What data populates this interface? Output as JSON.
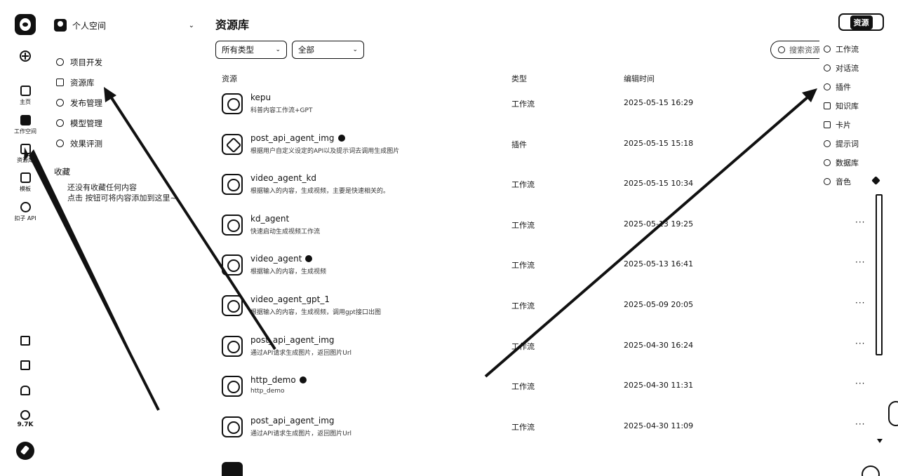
{
  "rail": {
    "items": [
      {
        "label": "主页",
        "icon": "home-icon"
      },
      {
        "label": "工作空间",
        "icon": "workspace-icon"
      },
      {
        "label": "资源库",
        "icon": "library-icon"
      },
      {
        "label": "模板",
        "icon": "template-icon"
      },
      {
        "label": "扣子 API",
        "icon": "api-icon"
      }
    ],
    "bottom": {
      "star_count": "9.7K"
    }
  },
  "sidebar": {
    "workspace": "个人空间",
    "menu": [
      {
        "label": "项目开发",
        "icon": "project-icon"
      },
      {
        "label": "资源库",
        "icon": "library-icon"
      },
      {
        "label": "发布管理",
        "icon": "rocket-icon"
      },
      {
        "label": "模型管理",
        "icon": "model-icon"
      },
      {
        "label": "效果评测",
        "icon": "evaluate-icon"
      }
    ],
    "favorites": {
      "title": "收藏",
      "empty_line1": "还没有收藏任何内容",
      "empty_line2": "点击 按钮可将内容添加到这里~"
    }
  },
  "main": {
    "title": "资源库",
    "type_filter": "所有类型",
    "scope_filter": "全部",
    "search_placeholder": "搜索资源",
    "resource_button": "资源",
    "columns": {
      "resource": "资源",
      "type": "类型",
      "edited": "编辑时间"
    },
    "rows": [
      {
        "name": "kepu",
        "desc": "科普内容工作流+GPT",
        "type": "工作流",
        "time": "2025-05-15 16:29",
        "badge": false,
        "icon": "workflow-icon"
      },
      {
        "name": "post_api_agent_img",
        "desc": "根据用户自定义设定的API以及提示词去调用生成图片",
        "type": "插件",
        "time": "2025-05-15 15:18",
        "badge": true,
        "icon": "plugin-icon"
      },
      {
        "name": "video_agent_kd",
        "desc": "根据输入的内容，生成视频，主要是快速相关的。",
        "type": "工作流",
        "time": "2025-05-15 10:34",
        "badge": false,
        "icon": "workflow-icon"
      },
      {
        "name": "kd_agent",
        "desc": "快速启动生成视频工作流",
        "type": "工作流",
        "time": "2025-05-13 19:25",
        "badge": false,
        "icon": "workflow-icon"
      },
      {
        "name": "video_agent",
        "desc": "根据输入的内容，生成视频",
        "type": "工作流",
        "time": "2025-05-13 16:41",
        "badge": true,
        "icon": "workflow-icon"
      },
      {
        "name": "video_agent_gpt_1",
        "desc": "根据输入的内容，生成视频，调用gpt接口出图",
        "type": "工作流",
        "time": "2025-05-09 20:05",
        "badge": false,
        "icon": "workflow-icon"
      },
      {
        "name": "post_api_agent_img",
        "desc": "通过API请求生成图片，返回图片Url",
        "type": "工作流",
        "time": "2025-04-30 16:24",
        "badge": false,
        "icon": "workflow-icon"
      },
      {
        "name": "http_demo",
        "desc": "http_demo",
        "type": "工作流",
        "time": "2025-04-30 11:31",
        "badge": true,
        "icon": "workflow-icon"
      },
      {
        "name": "post_api_agent_img",
        "desc": "通过API请求生成图片，返回图片Url",
        "type": "工作流",
        "time": "2025-04-30 11:09",
        "badge": false,
        "icon": "workflow-icon"
      }
    ],
    "more_label": "···"
  },
  "create_menu": {
    "items": [
      {
        "label": "工作流",
        "icon": "workflow-icon"
      },
      {
        "label": "对话流",
        "icon": "chatflow-icon"
      },
      {
        "label": "插件",
        "icon": "plugin-icon"
      },
      {
        "label": "知识库",
        "icon": "knowledge-icon"
      },
      {
        "label": "卡片",
        "icon": "card-icon"
      },
      {
        "label": "提示词",
        "icon": "prompt-icon"
      },
      {
        "label": "数据库",
        "icon": "database-icon"
      },
      {
        "label": "音色",
        "icon": "voice-icon"
      }
    ]
  }
}
